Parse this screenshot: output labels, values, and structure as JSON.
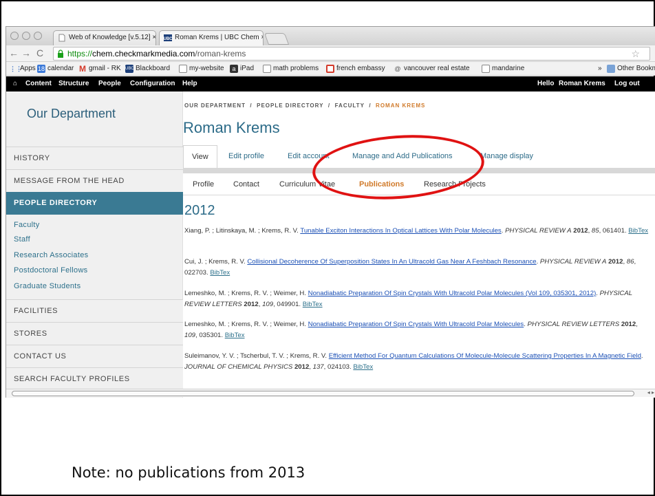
{
  "browser": {
    "tabs": [
      {
        "title": "Web of Knowledge [v.5.12] ×",
        "icon": "page-icon"
      },
      {
        "title": "Roman Krems | UBC Chem ×",
        "icon": "ubc-favicon"
      }
    ],
    "url": {
      "scheme": "https://",
      "host": "chem.checkmarkmedia.com",
      "path": "/roman-krems"
    },
    "bookmarks": [
      "Apps",
      "calendar",
      "gmail - RK",
      "Blackboard",
      "my-website",
      "iPad",
      "math problems",
      "french embassy",
      "vancouver real estate",
      "mandarine",
      "»",
      "Other Bookmarks"
    ],
    "calendar_number": "18"
  },
  "admin_bar": {
    "items": [
      "Content",
      "Structure",
      "People",
      "Configuration",
      "Help"
    ],
    "greeting_prefix": "Hello ",
    "greeting_name": "Roman Krems",
    "logout": "Log out"
  },
  "sidebar": {
    "title": "Our Department",
    "items": [
      "HISTORY",
      "MESSAGE FROM THE HEAD",
      "PEOPLE DIRECTORY"
    ],
    "sub_items": [
      "Faculty",
      "Staff",
      "Research Associates",
      "Postdoctoral Fellows",
      "Graduate Students"
    ],
    "bottom_items": [
      "FACILITIES",
      "STORES",
      "CONTACT US",
      "SEARCH FACULTY PROFILES"
    ]
  },
  "main": {
    "breadcrumb": [
      "OUR DEPARTMENT",
      "/",
      "PEOPLE DIRECTORY",
      "/",
      "FACULTY",
      "/",
      "ROMAN KREMS"
    ],
    "title": "Roman Krems",
    "tabs": [
      "View",
      "Edit profile",
      "Edit account",
      "Manage and Add Publications",
      "Manage display"
    ],
    "subtabs": [
      "Profile",
      "Contact",
      "Curriculum Vitae",
      "Publications",
      "Research Projects"
    ],
    "year": "2012",
    "publications": [
      {
        "authors": "Xiang, P. ; Litinskaya, M. ; Krems, R. V. ",
        "title": "Tunable Exciton Interactions In Optical Lattices With Polar Molecules",
        "journal": "PHYSICAL REVIEW A",
        "year": "2012",
        "volume": "85",
        "pages": ", 061401. ",
        "bibtex": "BibTex"
      },
      {
        "authors": "Cui, J. ; Krems, R. V. ",
        "title": "Collisional Decoherence Of Superposition States In An Ultracold Gas Near A Feshbach Resonance",
        "journal": "PHYSICAL REVIEW A",
        "year": "2012",
        "volume": "86",
        "pages": ", 022703. ",
        "bibtex": "BibTex"
      },
      {
        "authors": "Lemeshko, M. ; Krems, R. V. ; Weimer, H. ",
        "title": "Nonadiabatic Preparation Of Spin Crystals With Ultracold Polar Molecules (Vol 109, 035301, 2012)",
        "journal": "PHYSICAL REVIEW LETTERS",
        "year": "2012",
        "volume": "109",
        "pages": ", 049901. ",
        "bibtex": "BibTex"
      },
      {
        "authors": "Lemeshko, M. ; Krems, R. V. ; Weimer, H. ",
        "title": "Nonadiabatic Preparation Of Spin Crystals With Ultracold Polar Molecules",
        "journal": "PHYSICAL REVIEW LETTERS",
        "year": "2012",
        "volume": "109",
        "pages": ", 035301. ",
        "bibtex": "BibTex"
      },
      {
        "authors": "Suleimanov, Y. V. ; Tscherbul, T. V. ; Krems, R. V. ",
        "title": "Efficient Method For Quantum Calculations Of Molecule-Molecule Scattering Properties In A Magnetic Field",
        "journal": "JOURNAL OF CHEMICAL PHYSICS",
        "year": "2012",
        "volume": "137",
        "pages": ", 024103. ",
        "bibtex": "BibTex"
      }
    ]
  },
  "annotation": {
    "note": "Note: no publications from 2013",
    "ring_color": "#e01212"
  },
  "colors": {
    "brand": "#2c6b88",
    "sidebar_active": "#3a7a93",
    "accent": "#d07a2a"
  }
}
